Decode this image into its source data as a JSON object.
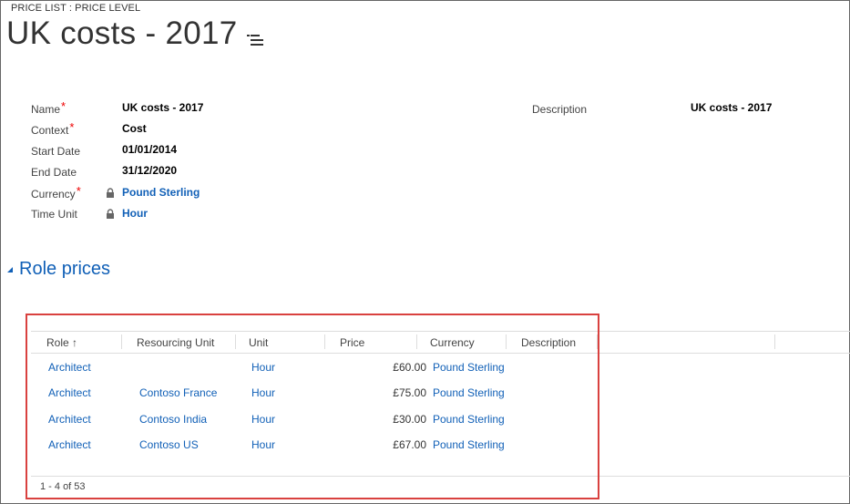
{
  "header": {
    "entity": "PRICE LIST : PRICE LEVEL",
    "title": "UK costs - 2017"
  },
  "fields": {
    "name_label": "Name",
    "name_value": "UK costs - 2017",
    "context_label": "Context",
    "context_value": "Cost",
    "start_label": "Start Date",
    "start_value": "01/01/2014",
    "end_label": "End Date",
    "end_value": "31/12/2020",
    "currency_label": "Currency",
    "currency_value": "Pound Sterling",
    "timeunit_label": "Time Unit",
    "timeunit_value": "Hour",
    "description_label": "Description",
    "description_value": "UK costs - 2017",
    "required_mark": "*"
  },
  "section": {
    "title": "Role prices"
  },
  "grid": {
    "columns": [
      "Role",
      "Resourcing Unit",
      "Unit",
      "Price",
      "Currency",
      "Description"
    ],
    "sort_arrow": "↑",
    "rows": [
      {
        "role": "Architect",
        "unit_res": "",
        "unit": "Hour",
        "price": "£60.00",
        "currency": "Pound Sterling"
      },
      {
        "role": "Architect",
        "unit_res": "Contoso France",
        "unit": "Hour",
        "price": "£75.00",
        "currency": "Pound Sterling"
      },
      {
        "role": "Architect",
        "unit_res": "Contoso India",
        "unit": "Hour",
        "price": "£30.00",
        "currency": "Pound Sterling"
      },
      {
        "role": "Architect",
        "unit_res": "Contoso US",
        "unit": "Hour",
        "price": "£67.00",
        "currency": "Pound Sterling"
      }
    ],
    "pager": "1 - 4 of 53"
  },
  "icons": {
    "menu": "menu-list-icon",
    "lock": "lock-icon",
    "collapse": "collapse-triangle-icon"
  },
  "colors": {
    "link": "#1160b7",
    "required": "#e00000",
    "highlight": "#d9413f"
  }
}
